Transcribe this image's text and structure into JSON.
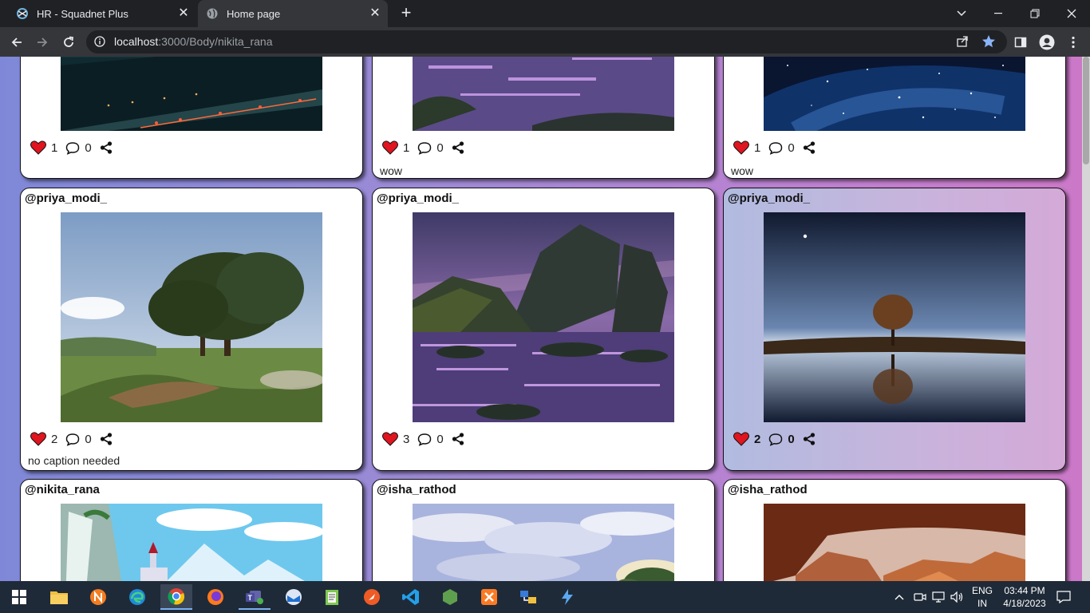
{
  "browser": {
    "tabs": [
      {
        "title": "HR - Squadnet Plus",
        "active": false
      },
      {
        "title": "Home page",
        "active": true
      }
    ],
    "url": {
      "host": "localhost",
      "path": ":3000/Body/nikita_rana"
    }
  },
  "posts": [
    {
      "username": "",
      "likes": "1",
      "comments": "0",
      "caption": "",
      "image": "night-city-street"
    },
    {
      "username": "",
      "likes": "1",
      "comments": "0",
      "caption": "wow",
      "image": "purple-lake"
    },
    {
      "username": "",
      "likes": "1",
      "comments": "0",
      "caption": "wow",
      "image": "galaxy-sky"
    },
    {
      "username": "@priya_modi_",
      "likes": "2",
      "comments": "0",
      "caption": "no caption needed",
      "image": "oak-tree-meadow"
    },
    {
      "username": "@priya_modi_",
      "likes": "3",
      "comments": "0",
      "caption": "",
      "image": "purple-mountains-lake"
    },
    {
      "username": "@priya_modi_",
      "likes": "2",
      "comments": "0",
      "caption": "",
      "image": "lone-tree-reflection"
    },
    {
      "username": "@nikita_rana",
      "likes": "",
      "comments": "",
      "caption": "",
      "image": "snowy-mountain-castle"
    },
    {
      "username": "@isha_rathod",
      "likes": "",
      "comments": "",
      "caption": "",
      "image": "clouds-sky"
    },
    {
      "username": "@isha_rathod",
      "likes": "",
      "comments": "",
      "caption": "",
      "image": "red-rock-arch"
    }
  ],
  "taskbar": {
    "language": {
      "line1": "ENG",
      "line2": "IN"
    },
    "time": "03:44 PM",
    "date": "4/18/2023",
    "apps": [
      "start-icon",
      "file-explorer-icon",
      "app-n-icon",
      "edge-icon",
      "chrome-icon",
      "firefox-icon",
      "teams-icon",
      "mail-app-icon",
      "notepad-icon",
      "postman-icon",
      "vscode-icon",
      "node-icon",
      "xampp-icon",
      "network-tool-icon",
      "power-automate-icon"
    ]
  },
  "colors": {
    "heart": "#e0151f",
    "accent": "#8ab4f8"
  }
}
